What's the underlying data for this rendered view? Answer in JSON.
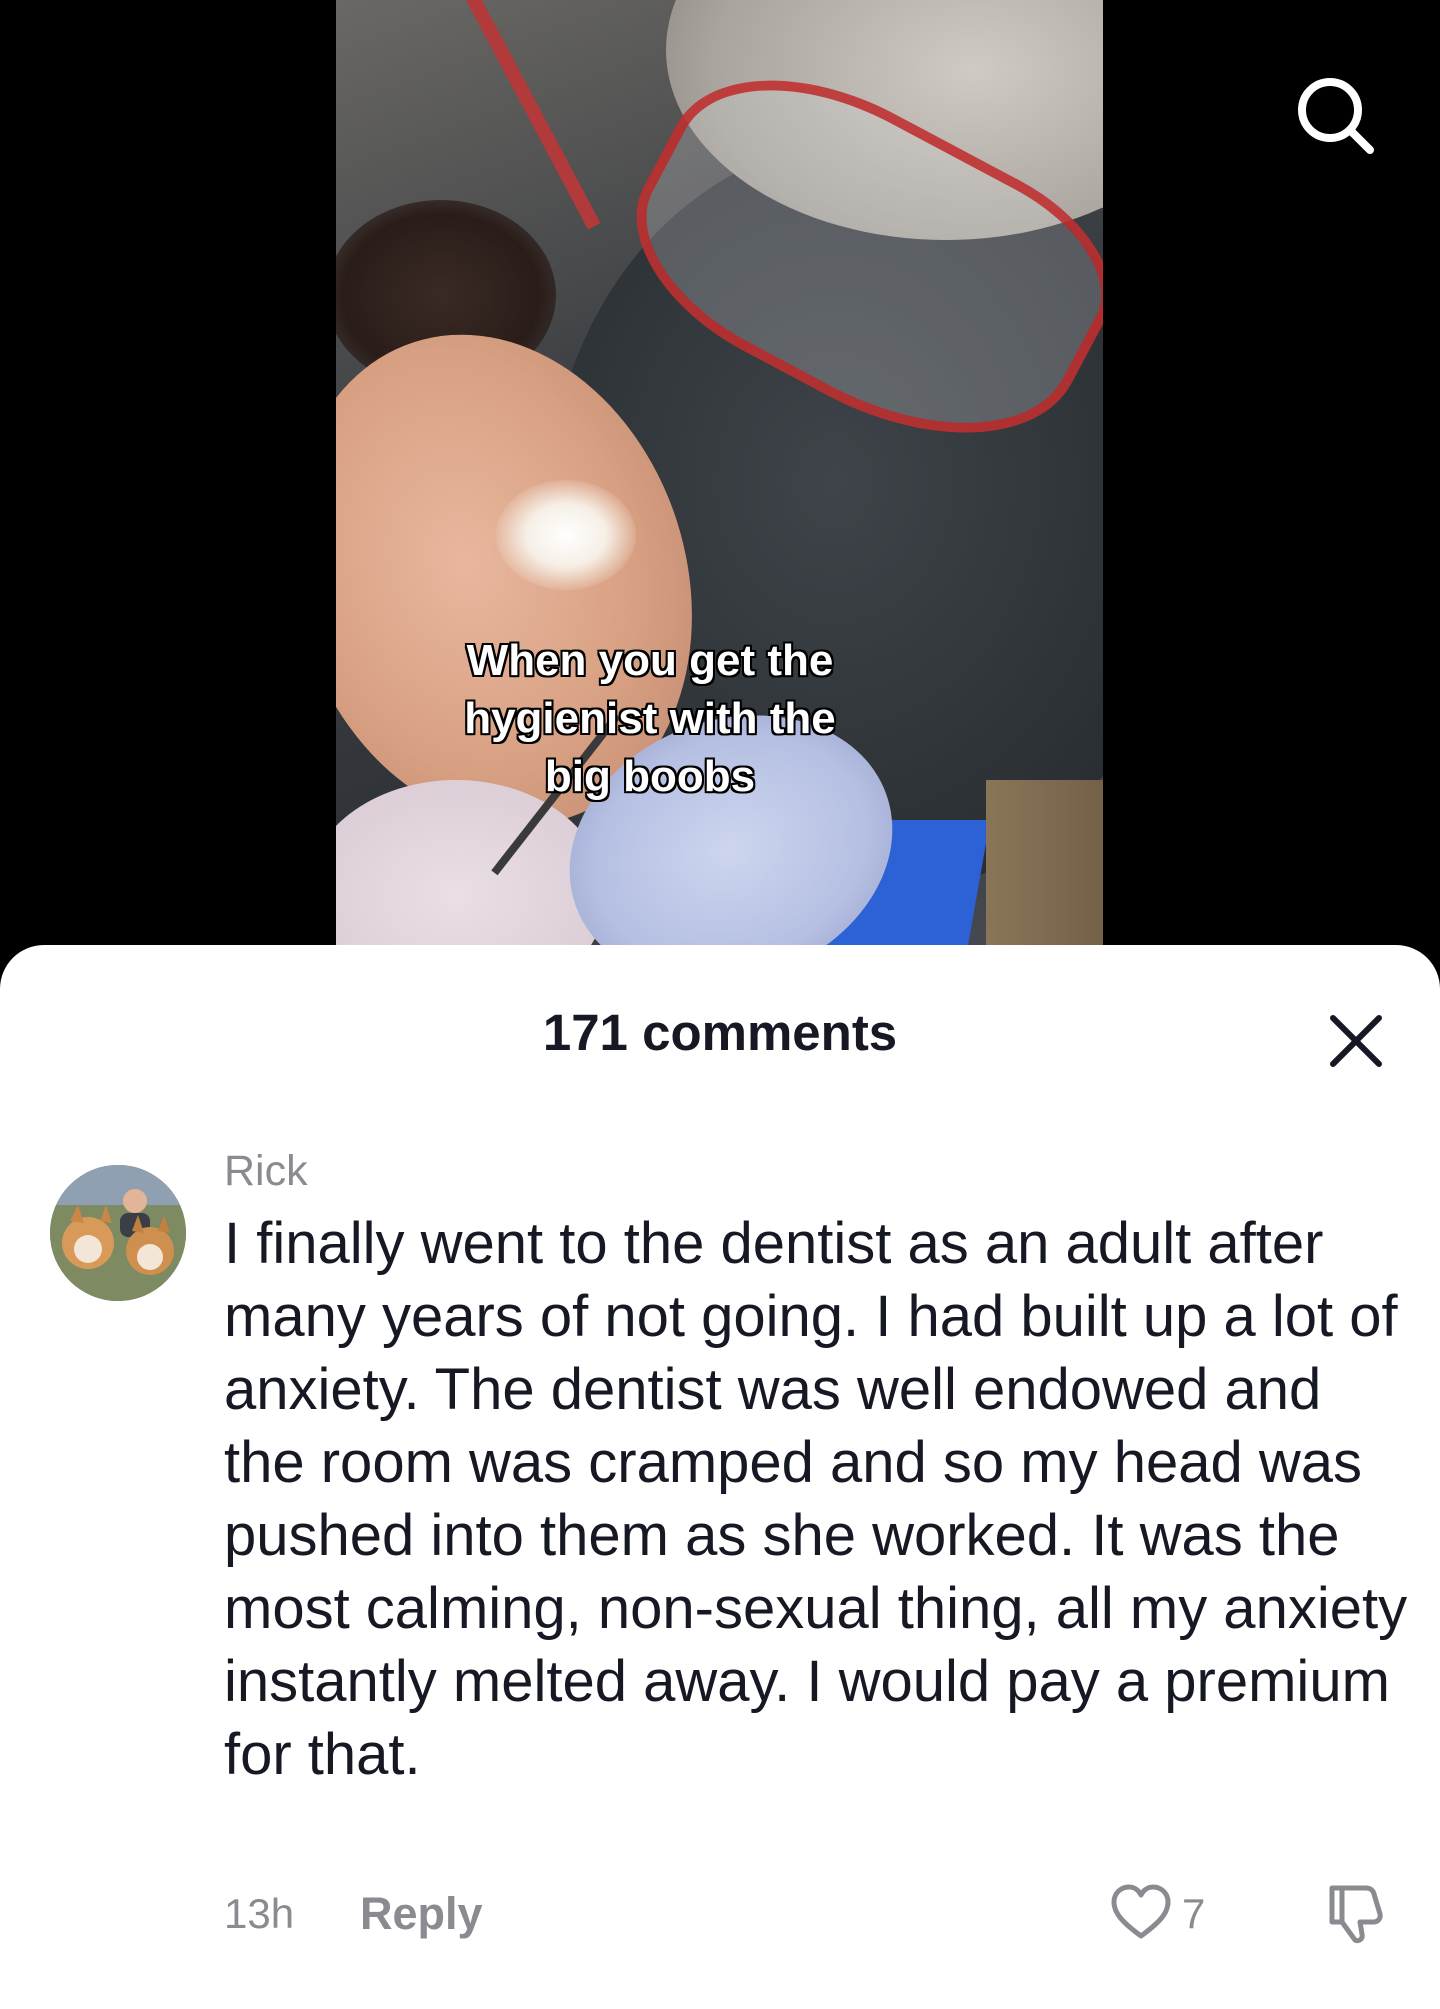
{
  "video": {
    "caption_lines": [
      "When you get the",
      "hygienist with the",
      "big boobs"
    ]
  },
  "top_bar": {
    "search_icon": "search-icon"
  },
  "comments_panel": {
    "title": "171 comments",
    "close_icon": "close-icon",
    "comments": [
      {
        "author": "Rick",
        "text": "I finally went to the dentist as an adult after many years of not going. I had built up a lot of anxiety. The dentist was well endowed and the room was cramped and so my head was pushed into them as she worked. It was the most calming, non-sexual thing, all my anxiety instantly melted away. I would pay a premium for that.",
        "time": "13h",
        "reply_label": "Reply",
        "like_count": "7",
        "like_icon": "heart-outline-icon",
        "dislike_icon": "thumbs-down-icon"
      }
    ]
  },
  "colors": {
    "sheet_background": "#ffffff",
    "primary_text": "#161823",
    "secondary_text": "#8a8b91",
    "page_background": "#000000"
  }
}
